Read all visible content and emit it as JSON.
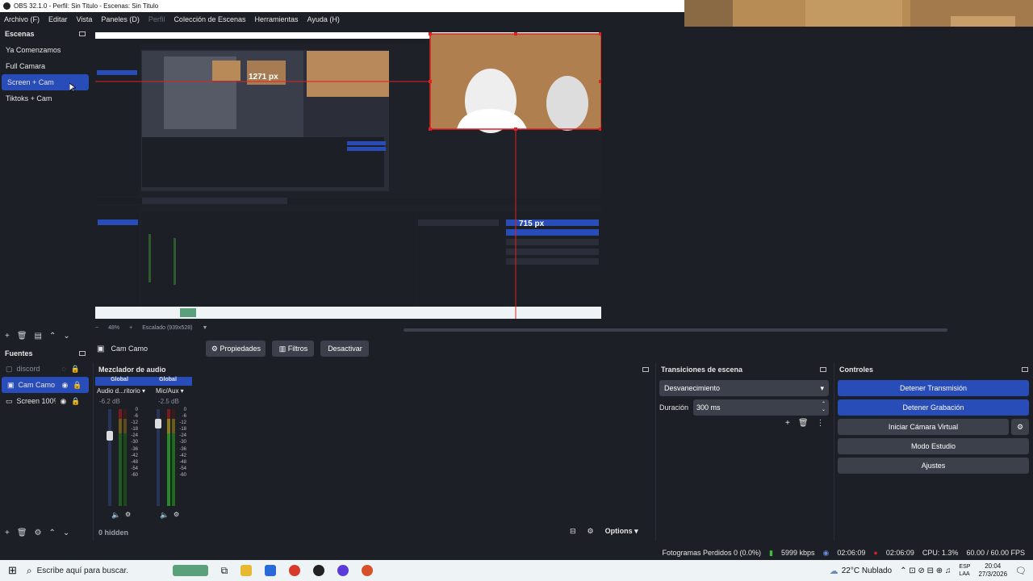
{
  "window": {
    "title": "OBS 32.1.0 - Perfil: Sin Titulo - Escenas: Sin Titulo"
  },
  "menu": [
    "Archivo (F)",
    "Editar",
    "Vista",
    "Paneles (D)",
    "Perfil",
    "Colección de Escenas",
    "Herramientas",
    "Ayuda (H)"
  ],
  "scenes": {
    "title": "Escenas",
    "items": [
      "Ya Comenzamos",
      "Full Camara",
      "Screen + Cam",
      "Tiktoks + Cam"
    ],
    "selected_index": 2
  },
  "preview": {
    "px_label_1": "1271 px",
    "px_label_2": "715 px",
    "zoom": "48%",
    "scaled": "Escalado (939x528)"
  },
  "sources": {
    "title": "Fuentes",
    "items": [
      "discord",
      "Cam Camo",
      "Screen 100%"
    ]
  },
  "source_toolbar": {
    "selected": "Cam Camo",
    "properties": "Propiedades",
    "filters": "Filtros",
    "deactivate": "Desactivar"
  },
  "mixer": {
    "title": "Mezclador de audio",
    "channels": [
      {
        "group": "Global",
        "name": "Audio d...ritorio",
        "db": "-6.2 dB",
        "level": 0.72
      },
      {
        "group": "Global",
        "name": "Mic/Aux",
        "db": "-2.5 dB",
        "level": 0.85
      }
    ],
    "scale": [
      "0",
      "-6",
      "-12",
      "-18",
      "-24",
      "-30",
      "-36",
      "-42",
      "-48",
      "-54",
      "-60"
    ],
    "hidden": "0 hidden",
    "options": "Options"
  },
  "transitions": {
    "title": "Transiciones de escena",
    "type": "Desvanecimiento",
    "duration_label": "Duración",
    "duration_value": "300 ms"
  },
  "controls": {
    "title": "Controles",
    "buttons": [
      "Detener Transmisión",
      "Detener Grabación",
      "Iniciar Cámara Virtual",
      "Modo Estudio",
      "Ajustes"
    ]
  },
  "status": {
    "dropped": "Fotogramas Perdidos 0 (0.0%)",
    "bitrate": "5999 kbps",
    "stream_time": "02:06:09",
    "rec_time": "02:06:09",
    "cpu": "CPU: 1.3%",
    "fps": "60.00 / 60.00 FPS"
  },
  "taskbar": {
    "search_placeholder": "Escribe aquí para buscar.",
    "weather": "22°C  Nublado",
    "lang1": "ESP",
    "lang2": "LAA",
    "time": "20:04",
    "date": "27/3/2026"
  },
  "colors": {
    "accent": "#284cb8",
    "bg": "#1d1f26",
    "panel": "#3c404b",
    "selection_red": "#e02020"
  }
}
